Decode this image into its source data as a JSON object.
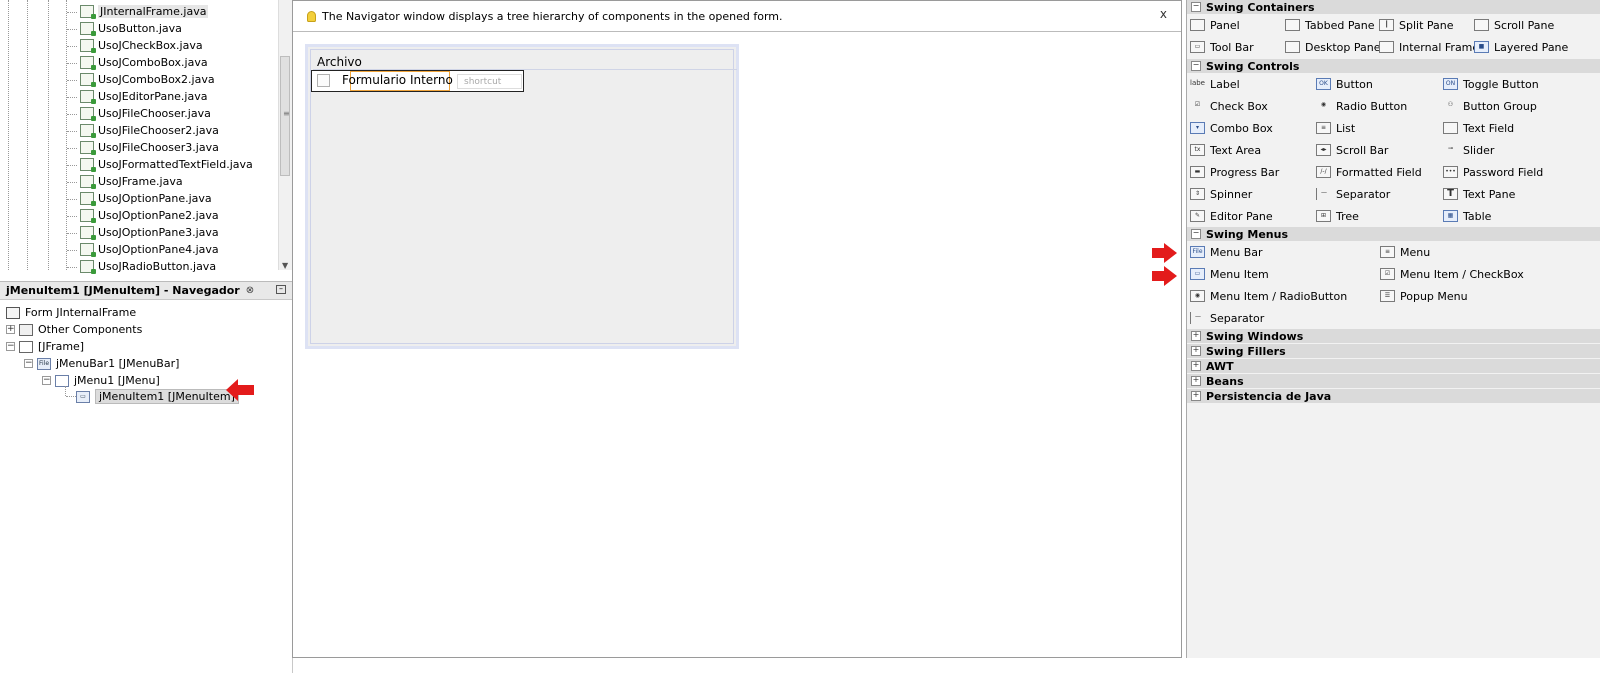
{
  "projects": {
    "files": [
      "JInternalFrame.java",
      "UsoButton.java",
      "UsoJCheckBox.java",
      "UsoJComboBox.java",
      "UsoJComboBox2.java",
      "UsoJEditorPane.java",
      "UsoJFileChooser.java",
      "UsoJFileChooser2.java",
      "UsoJFileChooser3.java",
      "UsoJFormattedTextField.java",
      "UsoJFrame.java",
      "UsoJOptionPane.java",
      "UsoJOptionPane2.java",
      "UsoJOptionPane3.java",
      "UsoJOptionPane4.java",
      "UsoJRadioButton.java"
    ]
  },
  "navigator": {
    "title": "jMenuItem1 [JMenuItem] - Navegador",
    "close": "⊗",
    "nodes": {
      "form": "Form JInternalFrame",
      "other": "Other Components",
      "jframe": "[JFrame]",
      "menubar": "jMenuBar1 [JMenuBar]",
      "menu": "jMenu1 [JMenu]",
      "menuitem": "jMenuItem1 [JMenuItem]"
    },
    "icon_menubar": "File"
  },
  "editor": {
    "hint": "The Navigator window displays a tree hierarchy of components in the opened form.",
    "hint_close": "x",
    "menu_label": "Archivo",
    "menu_item_label": "Formulario Interno",
    "shortcut": "shortcut"
  },
  "palette": {
    "categories": {
      "containers": "Swing Containers",
      "controls": "Swing Controls",
      "menus": "Swing Menus",
      "windows": "Swing Windows",
      "fillers": "Swing Fillers",
      "awt": "AWT",
      "beans": "Beans",
      "persistence": "Persistencia de Java"
    },
    "containers": [
      "Panel",
      "Tabbed Pane",
      "Split Pane",
      "Scroll Pane",
      "Tool Bar",
      "Desktop Pane",
      "Internal Frame",
      "Layered Pane"
    ],
    "controls": [
      "Label",
      "Button",
      "Toggle Button",
      "Check Box",
      "Radio Button",
      "Button Group",
      "Combo Box",
      "List",
      "Text Field",
      "Text Area",
      "Scroll Bar",
      "Slider",
      "Progress Bar",
      "Formatted Field",
      "Password Field",
      "Spinner",
      "Separator",
      "Text Pane",
      "Editor Pane",
      "Tree",
      "Table"
    ],
    "menus": [
      "Menu Bar",
      "Menu",
      "Menu Item",
      "Menu Item / CheckBox",
      "Menu Item / RadioButton",
      "Popup Menu",
      "Separator"
    ],
    "icon_text": {
      "label": "label",
      "button": "OK",
      "toggle": "ON",
      "textarea": "tx",
      "file": "File"
    }
  },
  "colors": {
    "arrow": "#e31b1b",
    "selection_border": "#f0a53c",
    "category_bg": "#dadada"
  }
}
